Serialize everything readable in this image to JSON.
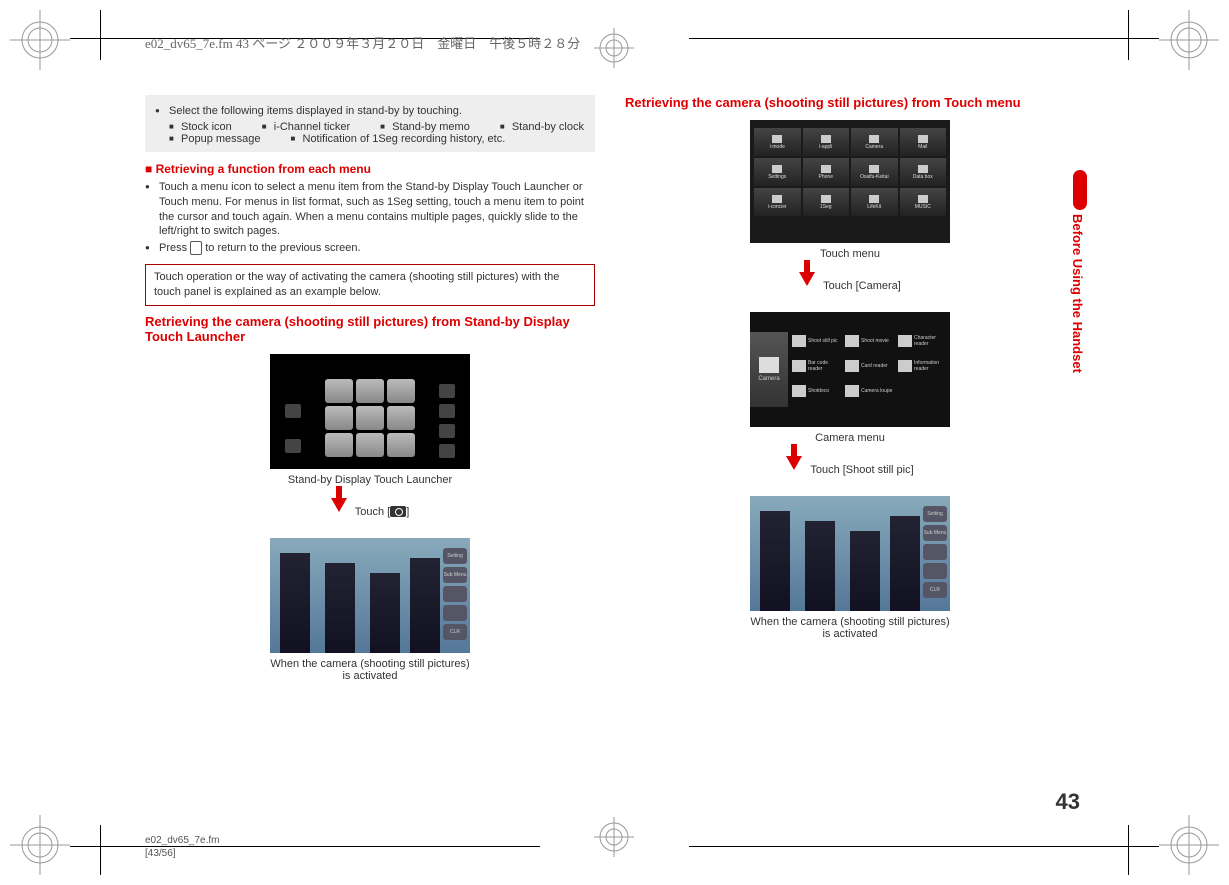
{
  "header_path": "e02_dv65_7e.fm  43 ページ  ２００９年３月２０日　金曜日　午後５時２８分",
  "footer_path_line1": "e02_dv65_7e.fm",
  "footer_path_line2": "[43/56]",
  "page_number": "43",
  "side_tab": "Before Using the Handset",
  "left": {
    "standby_intro": "Select the following items displayed in stand-by by touching.",
    "standby_items": [
      "Stock icon",
      "i-Channel ticker",
      "Stand-by memo",
      "Stand-by clock",
      "Popup message",
      "Notification of 1Seg recording history, etc."
    ],
    "sec_title": "Retrieving a function from each menu",
    "bullet1": "Touch a menu icon to select a menu item from the Stand-by Display Touch Launcher or Touch menu. For menus in list format, such as 1Seg setting, touch a menu item to point the cursor and touch again. When a menu contains multiple pages, quickly slide to the left/right to switch pages.",
    "bullet2_a": "Press ",
    "bullet2_b": " to return to the previous screen.",
    "note": "Touch operation or the way of activating the camera (shooting still pictures) with the touch panel is explained as an example below.",
    "sub_title": "Retrieving the camera (shooting still pictures) from Stand-by Display Touch Launcher",
    "cap_standby": "Stand-by Display Touch Launcher",
    "arrow1_a": "Touch [",
    "arrow1_b": "]",
    "cap_active": "When the camera (shooting still pictures) is activated"
  },
  "right": {
    "sub_title": "Retrieving the camera (shooting still pictures) from Touch menu",
    "touch_menu_items": [
      "i-mode",
      "i-appli",
      "Camera",
      "Mail",
      "Settings",
      "Phone",
      "Osaifu-Keitai",
      "Data box",
      "i-concier",
      "1Seg",
      "LifeKit",
      "MUSIC"
    ],
    "cap_touch_menu": "Touch menu",
    "arrow1": "Touch [Camera]",
    "camera_menu_side": "Camera",
    "camera_menu_items": [
      "Shoot still pic",
      "Shoot movie",
      "Character reader",
      "Bar code reader",
      "Card reader",
      "Information reader",
      "Shotdeco",
      "Camera loupe"
    ],
    "cap_camera_menu": "Camera menu",
    "arrow2": "Touch [Shoot still pic]",
    "cap_active": "When the camera (shooting still pictures) is activated",
    "cam_btns": [
      "Setting",
      "Sub Menu",
      "",
      "",
      "CLR",
      ""
    ]
  }
}
